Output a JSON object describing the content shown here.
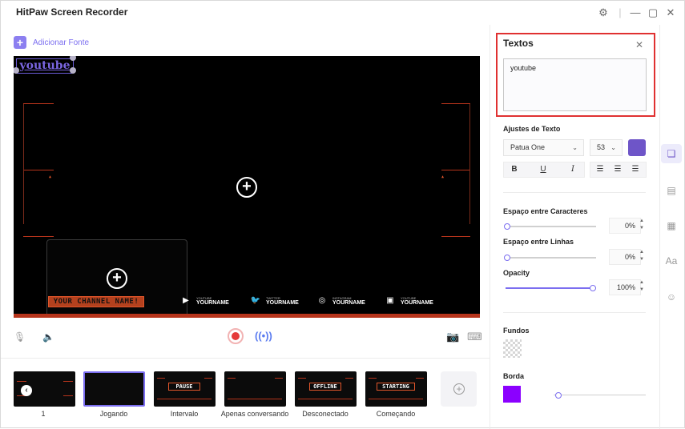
{
  "app": {
    "title": "HitPaw Screen Recorder"
  },
  "toolbar": {
    "add_source_label": "Adicionar Fonte"
  },
  "preview": {
    "text_overlay": "youtube",
    "channel_name": "YOUR CHANNEL NAME!",
    "socials": [
      {
        "platform": "YOUTUBE",
        "handle": "YOURNAME",
        "icon": "youtube-icon",
        "glyph": "▶"
      },
      {
        "platform": "TWITTER",
        "handle": "YOURNAME",
        "icon": "twitter-icon",
        "glyph": "🐦"
      },
      {
        "platform": "INSTAGRAM",
        "handle": "YOURNAME",
        "icon": "instagram-icon",
        "glyph": "◎"
      },
      {
        "platform": "YOUTUBE",
        "handle": "YOURNAME",
        "icon": "twitch-icon",
        "glyph": "▣"
      }
    ],
    "accent_color": "#b6341b"
  },
  "scenes": [
    {
      "label": "1",
      "word": ""
    },
    {
      "label": "Jogando",
      "word": ""
    },
    {
      "label": "Intervalo",
      "word": "PAUSE"
    },
    {
      "label": "Apenas conversando",
      "word": ""
    },
    {
      "label": "Desconectado",
      "word": "OFFLINE"
    },
    {
      "label": "Começando",
      "word": "STARTING"
    }
  ],
  "panel": {
    "title": "Textos",
    "text_value": "youtube",
    "text_settings_title": "Ajustes de Texto",
    "font": "Patua One",
    "font_size": "53",
    "color": "#6e55c8",
    "bold": "B",
    "underline": "U",
    "italic": "I",
    "char_spacing_title": "Espaço entre Caracteres",
    "char_spacing_value": "0%",
    "line_spacing_title": "Espaço entre Linhas",
    "line_spacing_value": "0%",
    "opacity_title": "Opacity",
    "opacity_value": "100%",
    "backgrounds_title": "Fundos",
    "border_title": "Borda",
    "border_color": "#8b00ff"
  }
}
